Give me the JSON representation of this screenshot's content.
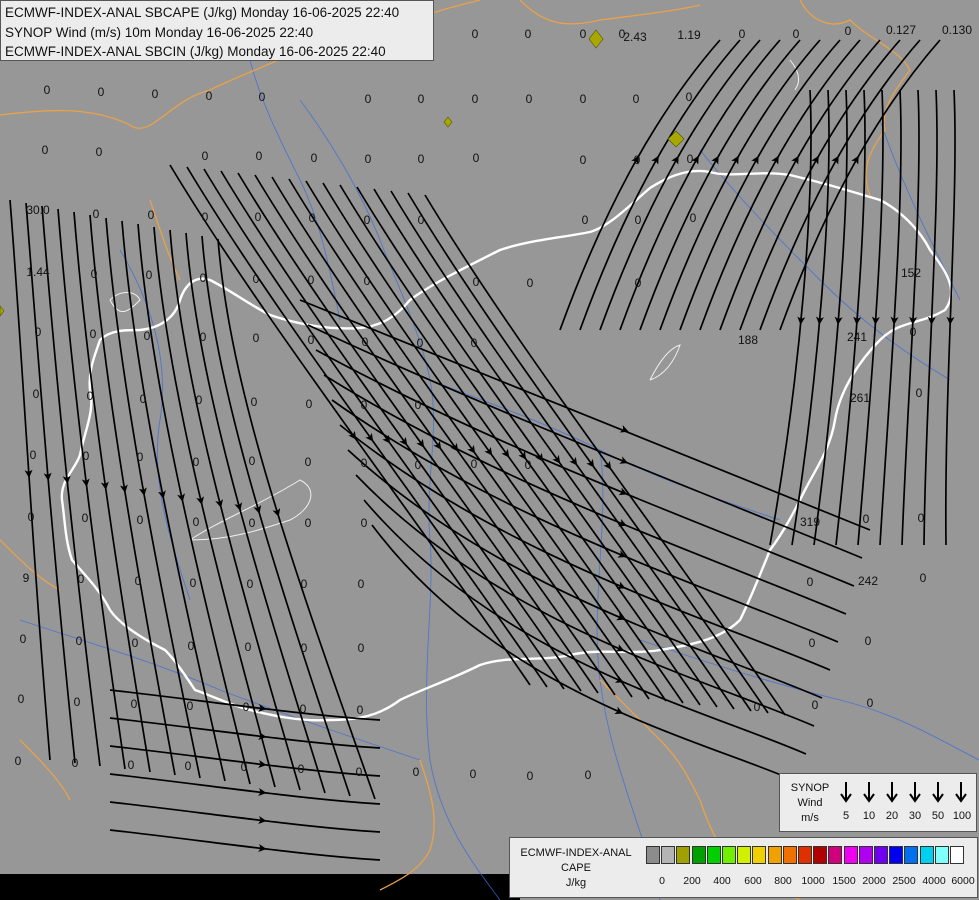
{
  "header": {
    "line1": "ECMWF-INDEX-ANAL SBCAPE (J/kg) Monday 16-06-2025 22:40",
    "line2": "SYNOP Wind (m/s) 10m Monday 16-06-2025 22:40",
    "line3": "ECMWF-INDEX-ANAL SBCIN (J/kg) Monday 16-06-2025 22:40"
  },
  "wind_legend": {
    "title_line1": "SYNOP",
    "title_line2": "Wind",
    "title_line3": "m/s",
    "values": [
      "5",
      "10",
      "20",
      "30",
      "50",
      "100"
    ]
  },
  "cape_legend": {
    "title_line1": "ECMWF-INDEX-ANAL",
    "title_line2": "CAPE",
    "title_line3": "J/kg",
    "colors": [
      "#8c8c8c",
      "#b4b4b4",
      "#a0a000",
      "#00a000",
      "#00d000",
      "#70f000",
      "#d0f000",
      "#f0d000",
      "#f0a000",
      "#f07000",
      "#e03000",
      "#b00000",
      "#d0007a",
      "#f000f0",
      "#b000f0",
      "#7000f0",
      "#0000f0",
      "#0070f0",
      "#00d0f0",
      "#80ffff",
      "#ffffff"
    ],
    "ticks": [
      "0",
      "200",
      "400",
      "600",
      "800",
      "1000",
      "1500",
      "2000",
      "2500",
      "4000",
      "6000"
    ]
  },
  "map_values": [
    "0",
    "0",
    "0",
    "0",
    "2.43",
    "1.19",
    "0",
    "0",
    "0",
    "0.127",
    "0.130",
    "0",
    "0",
    "0",
    "0",
    "0",
    "0",
    "0",
    "0",
    "0",
    "0",
    "0",
    "0",
    "0",
    "0",
    "0",
    "0",
    "0",
    "0",
    "0",
    "0",
    "0",
    "0",
    "0",
    "30.0",
    "0",
    "0",
    "0",
    "0",
    "0",
    "0",
    "0",
    "0",
    "0",
    "0",
    "1.44",
    "0",
    "0",
    "0",
    "0",
    "0",
    "0",
    "0",
    "0",
    "0",
    "152",
    "0",
    "0",
    "0",
    "0",
    "0",
    "0",
    "0",
    "0",
    "0",
    "188",
    "241",
    "0",
    "0",
    "0",
    "0",
    "0",
    "0",
    "0",
    "0",
    "0",
    "261",
    "0",
    "0",
    "0",
    "0",
    "0",
    "0",
    "0",
    "0",
    "0",
    "0",
    "0",
    "0",
    "0",
    "0",
    "0",
    "0",
    "0",
    "0",
    "319",
    "0",
    "0",
    "9",
    "0",
    "0",
    "0",
    "0",
    "0",
    "0",
    "0",
    "242",
    "0",
    "0",
    "0",
    "0",
    "0",
    "0",
    "0",
    "0",
    "0",
    "0",
    "0",
    "0",
    "0",
    "0",
    "0",
    "0",
    "0",
    "0",
    "0",
    "0",
    "0",
    "0",
    "0",
    "0",
    "0",
    "0",
    "0",
    "0",
    "0",
    "0",
    "0"
  ]
}
